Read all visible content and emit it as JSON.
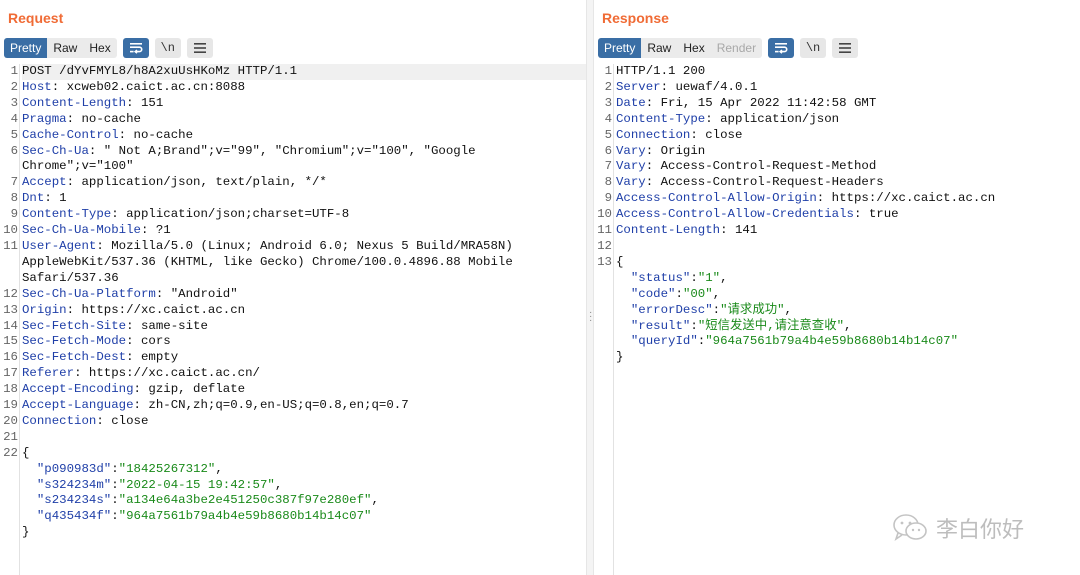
{
  "request": {
    "title": "Request",
    "tabs": [
      "Pretty",
      "Raw",
      "Hex"
    ],
    "active_tab": "Pretty",
    "lines": [
      {
        "n": "1",
        "hl": true,
        "parts": [
          [
            "t",
            "POST /dYvFMYL8/h8A2xuUsHKoMz HTTP/1.1"
          ]
        ]
      },
      {
        "n": "2",
        "parts": [
          [
            "h",
            "Host"
          ],
          [
            "t",
            ": xcweb02.caict.ac.cn:8088"
          ]
        ]
      },
      {
        "n": "3",
        "parts": [
          [
            "h",
            "Content-Length"
          ],
          [
            "t",
            ": 151"
          ]
        ]
      },
      {
        "n": "4",
        "parts": [
          [
            "h",
            "Pragma"
          ],
          [
            "t",
            ": no-cache"
          ]
        ]
      },
      {
        "n": "5",
        "parts": [
          [
            "h",
            "Cache-Control"
          ],
          [
            "t",
            ": no-cache"
          ]
        ]
      },
      {
        "n": "6",
        "parts": [
          [
            "h",
            "Sec-Ch-Ua"
          ],
          [
            "t",
            ": \" Not A;Brand\";v=\"99\", \"Chromium\";v=\"100\", \"Google"
          ]
        ]
      },
      {
        "n": "",
        "parts": [
          [
            "t",
            "Chrome\";v=\"100\""
          ]
        ]
      },
      {
        "n": "7",
        "parts": [
          [
            "h",
            "Accept"
          ],
          [
            "t",
            ": application/json, text/plain, */*"
          ]
        ]
      },
      {
        "n": "8",
        "parts": [
          [
            "h",
            "Dnt"
          ],
          [
            "t",
            ": 1"
          ]
        ]
      },
      {
        "n": "9",
        "parts": [
          [
            "h",
            "Content-Type"
          ],
          [
            "t",
            ": application/json;charset=UTF-8"
          ]
        ]
      },
      {
        "n": "10",
        "parts": [
          [
            "h",
            "Sec-Ch-Ua-Mobile"
          ],
          [
            "t",
            ": ?1"
          ]
        ]
      },
      {
        "n": "11",
        "parts": [
          [
            "h",
            "User-Agent"
          ],
          [
            "t",
            ": Mozilla/5.0 (Linux; Android 6.0; Nexus 5 Build/MRA58N)"
          ]
        ]
      },
      {
        "n": "",
        "parts": [
          [
            "t",
            "AppleWebKit/537.36 (KHTML, like Gecko) Chrome/100.0.4896.88 Mobile"
          ]
        ]
      },
      {
        "n": "",
        "parts": [
          [
            "t",
            "Safari/537.36"
          ]
        ]
      },
      {
        "n": "12",
        "parts": [
          [
            "h",
            "Sec-Ch-Ua-Platform"
          ],
          [
            "t",
            ": \"Android\""
          ]
        ]
      },
      {
        "n": "13",
        "parts": [
          [
            "h",
            "Origin"
          ],
          [
            "t",
            ": https://xc.caict.ac.cn"
          ]
        ]
      },
      {
        "n": "14",
        "parts": [
          [
            "h",
            "Sec-Fetch-Site"
          ],
          [
            "t",
            ": same-site"
          ]
        ]
      },
      {
        "n": "15",
        "parts": [
          [
            "h",
            "Sec-Fetch-Mode"
          ],
          [
            "t",
            ": cors"
          ]
        ]
      },
      {
        "n": "16",
        "parts": [
          [
            "h",
            "Sec-Fetch-Dest"
          ],
          [
            "t",
            ": empty"
          ]
        ]
      },
      {
        "n": "17",
        "parts": [
          [
            "h",
            "Referer"
          ],
          [
            "t",
            ": https://xc.caict.ac.cn/"
          ]
        ]
      },
      {
        "n": "18",
        "parts": [
          [
            "h",
            "Accept-Encoding"
          ],
          [
            "t",
            ": gzip, deflate"
          ]
        ]
      },
      {
        "n": "19",
        "parts": [
          [
            "h",
            "Accept-Language"
          ],
          [
            "t",
            ": zh-CN,zh;q=0.9,en-US;q=0.8,en;q=0.7"
          ]
        ]
      },
      {
        "n": "20",
        "parts": [
          [
            "h",
            "Connection"
          ],
          [
            "t",
            ": close"
          ]
        ]
      },
      {
        "n": "21",
        "parts": [
          [
            "t",
            ""
          ]
        ]
      },
      {
        "n": "22",
        "parts": [
          [
            "t",
            "{"
          ]
        ]
      },
      {
        "n": "",
        "parts": [
          [
            "t",
            "  "
          ],
          [
            "k",
            "\"p090983d\""
          ],
          [
            "t",
            ":"
          ],
          [
            "s",
            "\"18425267312\""
          ],
          [
            "t",
            ","
          ]
        ]
      },
      {
        "n": "",
        "parts": [
          [
            "t",
            "  "
          ],
          [
            "k",
            "\"s324234m\""
          ],
          [
            "t",
            ":"
          ],
          [
            "s",
            "\"2022-04-15 19:42:57\""
          ],
          [
            "t",
            ","
          ]
        ]
      },
      {
        "n": "",
        "parts": [
          [
            "t",
            "  "
          ],
          [
            "k",
            "\"s234234s\""
          ],
          [
            "t",
            ":"
          ],
          [
            "s",
            "\"a134e64a3be2e451250c387f97e280ef\""
          ],
          [
            "t",
            ","
          ]
        ]
      },
      {
        "n": "",
        "parts": [
          [
            "t",
            "  "
          ],
          [
            "k",
            "\"q435434f\""
          ],
          [
            "t",
            ":"
          ],
          [
            "s",
            "\"964a7561b79a4b4e59b8680b14b14c07\""
          ]
        ]
      },
      {
        "n": "",
        "parts": [
          [
            "t",
            "}"
          ]
        ]
      }
    ]
  },
  "response": {
    "title": "Response",
    "tabs": [
      "Pretty",
      "Raw",
      "Hex",
      "Render"
    ],
    "active_tab": "Pretty",
    "lines": [
      {
        "n": "1",
        "parts": [
          [
            "t",
            "HTTP/1.1 200"
          ]
        ]
      },
      {
        "n": "2",
        "parts": [
          [
            "h",
            "Server"
          ],
          [
            "t",
            ": uewaf/4.0.1"
          ]
        ]
      },
      {
        "n": "3",
        "parts": [
          [
            "h",
            "Date"
          ],
          [
            "t",
            ": Fri, 15 Apr 2022 11:42:58 GMT"
          ]
        ]
      },
      {
        "n": "4",
        "parts": [
          [
            "h",
            "Content-Type"
          ],
          [
            "t",
            ": application/json"
          ]
        ]
      },
      {
        "n": "5",
        "parts": [
          [
            "h",
            "Connection"
          ],
          [
            "t",
            ": close"
          ]
        ]
      },
      {
        "n": "6",
        "parts": [
          [
            "h",
            "Vary"
          ],
          [
            "t",
            ": Origin"
          ]
        ]
      },
      {
        "n": "7",
        "parts": [
          [
            "h",
            "Vary"
          ],
          [
            "t",
            ": Access-Control-Request-Method"
          ]
        ]
      },
      {
        "n": "8",
        "parts": [
          [
            "h",
            "Vary"
          ],
          [
            "t",
            ": Access-Control-Request-Headers"
          ]
        ]
      },
      {
        "n": "9",
        "parts": [
          [
            "h",
            "Access-Control-Allow-Origin"
          ],
          [
            "t",
            ": https://xc.caict.ac.cn"
          ]
        ]
      },
      {
        "n": "10",
        "parts": [
          [
            "h",
            "Access-Control-Allow-Credentials"
          ],
          [
            "t",
            ": true"
          ]
        ]
      },
      {
        "n": "11",
        "parts": [
          [
            "h",
            "Content-Length"
          ],
          [
            "t",
            ": 141"
          ]
        ]
      },
      {
        "n": "12",
        "parts": [
          [
            "t",
            ""
          ]
        ]
      },
      {
        "n": "13",
        "parts": [
          [
            "t",
            "{"
          ]
        ]
      },
      {
        "n": "",
        "parts": [
          [
            "t",
            "  "
          ],
          [
            "k",
            "\"status\""
          ],
          [
            "t",
            ":"
          ],
          [
            "s",
            "\"1\""
          ],
          [
            "t",
            ","
          ]
        ]
      },
      {
        "n": "",
        "parts": [
          [
            "t",
            "  "
          ],
          [
            "k",
            "\"code\""
          ],
          [
            "t",
            ":"
          ],
          [
            "s",
            "\"00\""
          ],
          [
            "t",
            ","
          ]
        ]
      },
      {
        "n": "",
        "parts": [
          [
            "t",
            "  "
          ],
          [
            "k",
            "\"errorDesc\""
          ],
          [
            "t",
            ":"
          ],
          [
            "s",
            "\"请求成功\""
          ],
          [
            "t",
            ","
          ]
        ]
      },
      {
        "n": "",
        "parts": [
          [
            "t",
            "  "
          ],
          [
            "k",
            "\"result\""
          ],
          [
            "t",
            ":"
          ],
          [
            "s",
            "\"短信发送中,请注意查收\""
          ],
          [
            "t",
            ","
          ]
        ]
      },
      {
        "n": "",
        "parts": [
          [
            "t",
            "  "
          ],
          [
            "k",
            "\"queryId\""
          ],
          [
            "t",
            ":"
          ],
          [
            "s",
            "\"964a7561b79a4b4e59b8680b14b14c07\""
          ]
        ]
      },
      {
        "n": "",
        "parts": [
          [
            "t",
            "}"
          ]
        ]
      }
    ]
  },
  "icons": {
    "wrap": "wrap-lines-icon",
    "newline": "\\n",
    "menu": "hamburger-menu-icon"
  },
  "watermark": {
    "text": "李白你好",
    "icon": "wechat-icon"
  }
}
